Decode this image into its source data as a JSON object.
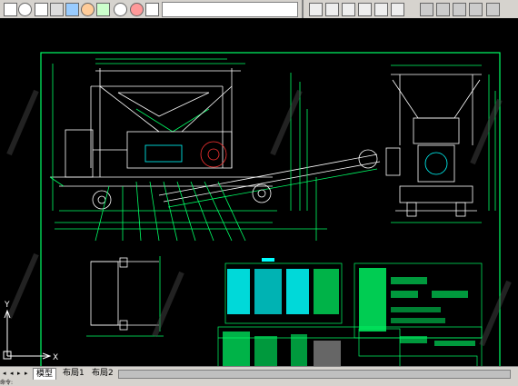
{
  "tabs": [
    {
      "label": "模型",
      "active": true
    },
    {
      "label": "布局1",
      "active": false
    },
    {
      "label": "布局2",
      "active": false
    }
  ],
  "ucs": {
    "y": "Y",
    "x": "X"
  },
  "toolbar_icons": [
    "new-icon",
    "open-icon",
    "save-icon",
    "print-icon",
    "layers-icon",
    "refresh-icon",
    "orbit-icon",
    "view-icon",
    "render-icon",
    "shade-icon"
  ],
  "toolbar_right_icons": [
    "view-top-icon",
    "view-front-icon",
    "view-left-icon",
    "view-right-icon",
    "view-back-icon",
    "view-bottom-icon",
    "iso-sw-icon",
    "iso-se-icon",
    "iso-ne-icon",
    "iso-nw-icon",
    "camera-icon"
  ],
  "colors": {
    "drawing": "#00ff66",
    "white": "#ffffff",
    "red": "#ff3333",
    "cyan": "#00ffff",
    "yellow": "#ffff00",
    "magenta": "#ff66ff"
  },
  "status_text": "命令:"
}
